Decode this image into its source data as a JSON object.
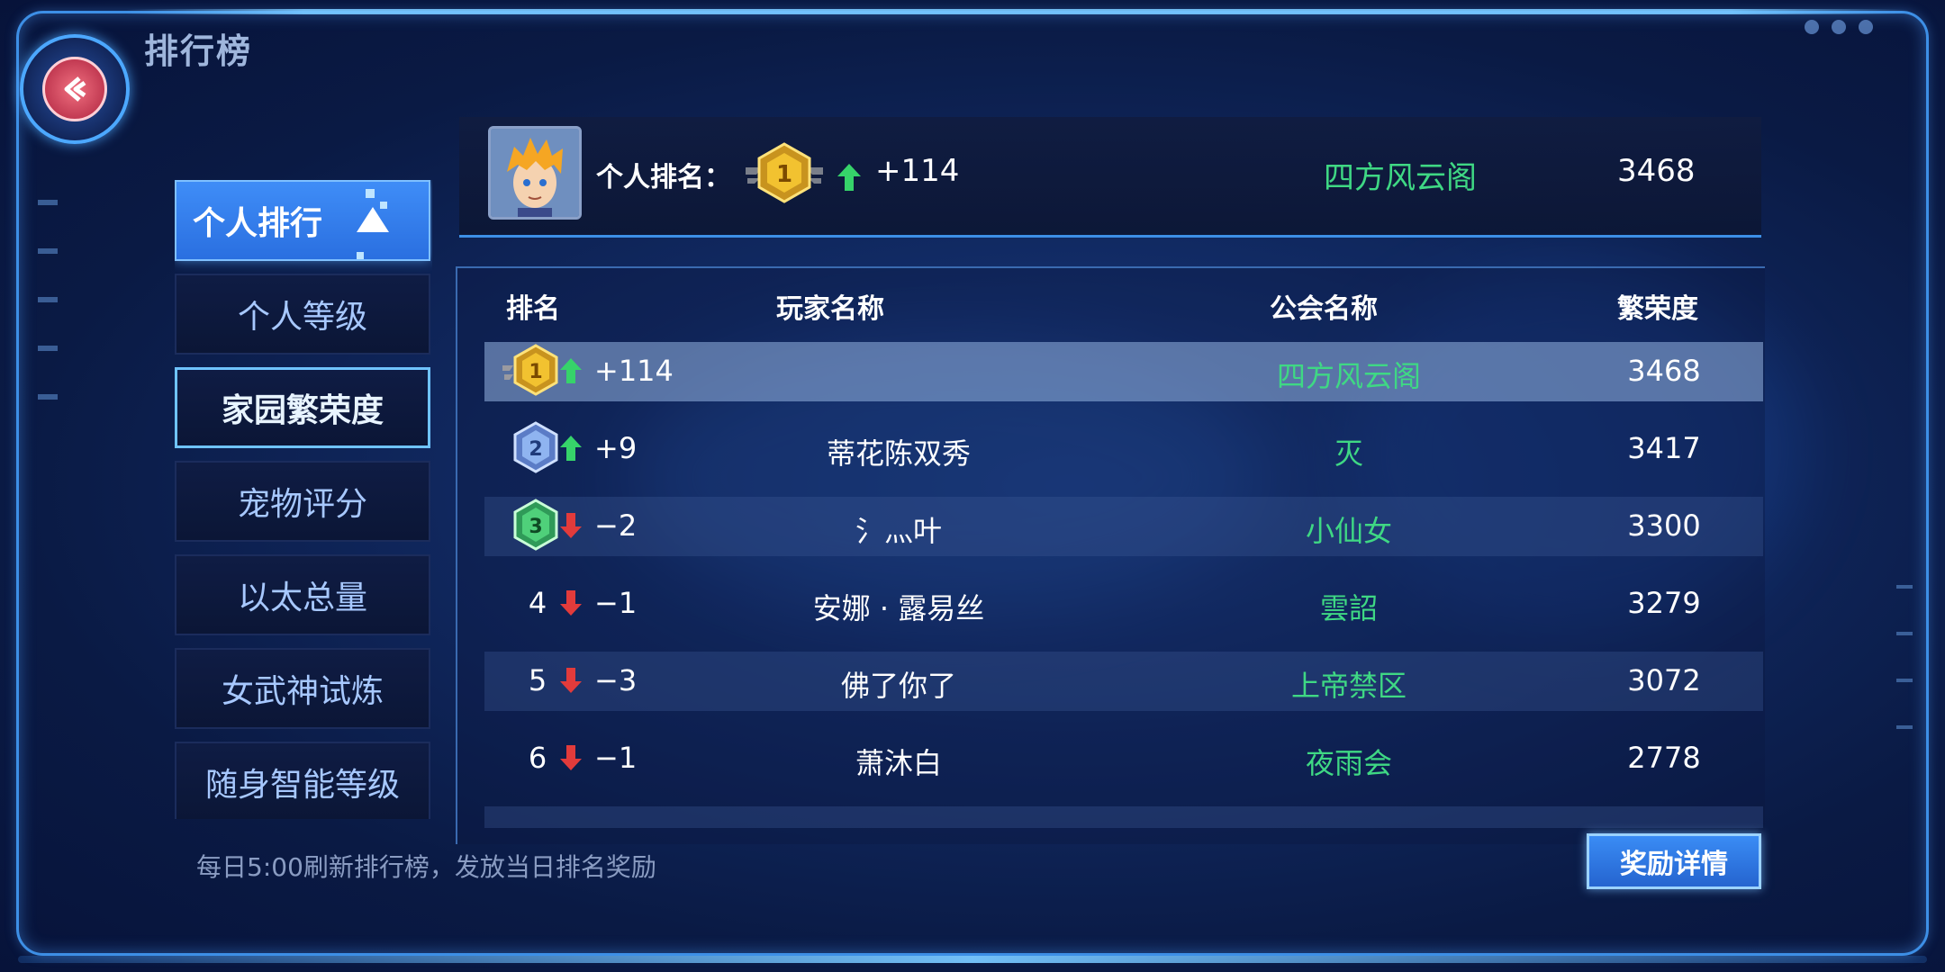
{
  "header": {
    "title": "排行榜"
  },
  "sidebar": {
    "items": [
      {
        "label": "个人排行",
        "state": "active"
      },
      {
        "label": "个人等级",
        "state": "normal"
      },
      {
        "label": "家园繁荣度",
        "state": "selected"
      },
      {
        "label": "宠物评分",
        "state": "normal"
      },
      {
        "label": "以太总量",
        "state": "normal"
      },
      {
        "label": "女武神试炼",
        "state": "normal"
      },
      {
        "label": "随身智能等级",
        "state": "normal"
      }
    ]
  },
  "my_rank": {
    "label": "个人排名：",
    "rank": "1",
    "change": "+114",
    "guild": "四方风云阁",
    "prosperity": "3468"
  },
  "table": {
    "headers": {
      "rank": "排名",
      "player": "玩家名称",
      "guild": "公会名称",
      "prosperity": "繁荣度"
    },
    "rows": [
      {
        "rank": "1",
        "trend": "up",
        "change": "+114",
        "player": "",
        "guild": "四方风云阁",
        "prosperity": "3468"
      },
      {
        "rank": "2",
        "trend": "up",
        "change": "+9",
        "player": "蒂花陈双秀",
        "guild": "灭",
        "prosperity": "3417"
      },
      {
        "rank": "3",
        "trend": "down",
        "change": "−2",
        "player": "氵灬叶",
        "guild": "小仙女",
        "prosperity": "3300"
      },
      {
        "rank": "4",
        "trend": "down",
        "change": "−1",
        "player": "安娜 · 露易丝",
        "guild": "雲詔",
        "prosperity": "3279"
      },
      {
        "rank": "5",
        "trend": "down",
        "change": "−3",
        "player": "佛了你了",
        "guild": "上帝禁区",
        "prosperity": "3072"
      },
      {
        "rank": "6",
        "trend": "down",
        "change": "−1",
        "player": "萧沐白",
        "guild": "夜雨会",
        "prosperity": "2778"
      }
    ]
  },
  "footer": {
    "note": "每日5:00刷新排行榜，发放当日排名奖励",
    "reward_button": "奖励详情"
  },
  "colors": {
    "guild_green": "#3fd884",
    "accent_blue": "#3d8fe6",
    "gold": "#f2c230",
    "silver": "#8fb4f0",
    "bronze_green": "#4fd07a",
    "up_arrow": "#36d36a",
    "down_arrow": "#e23b3b"
  }
}
